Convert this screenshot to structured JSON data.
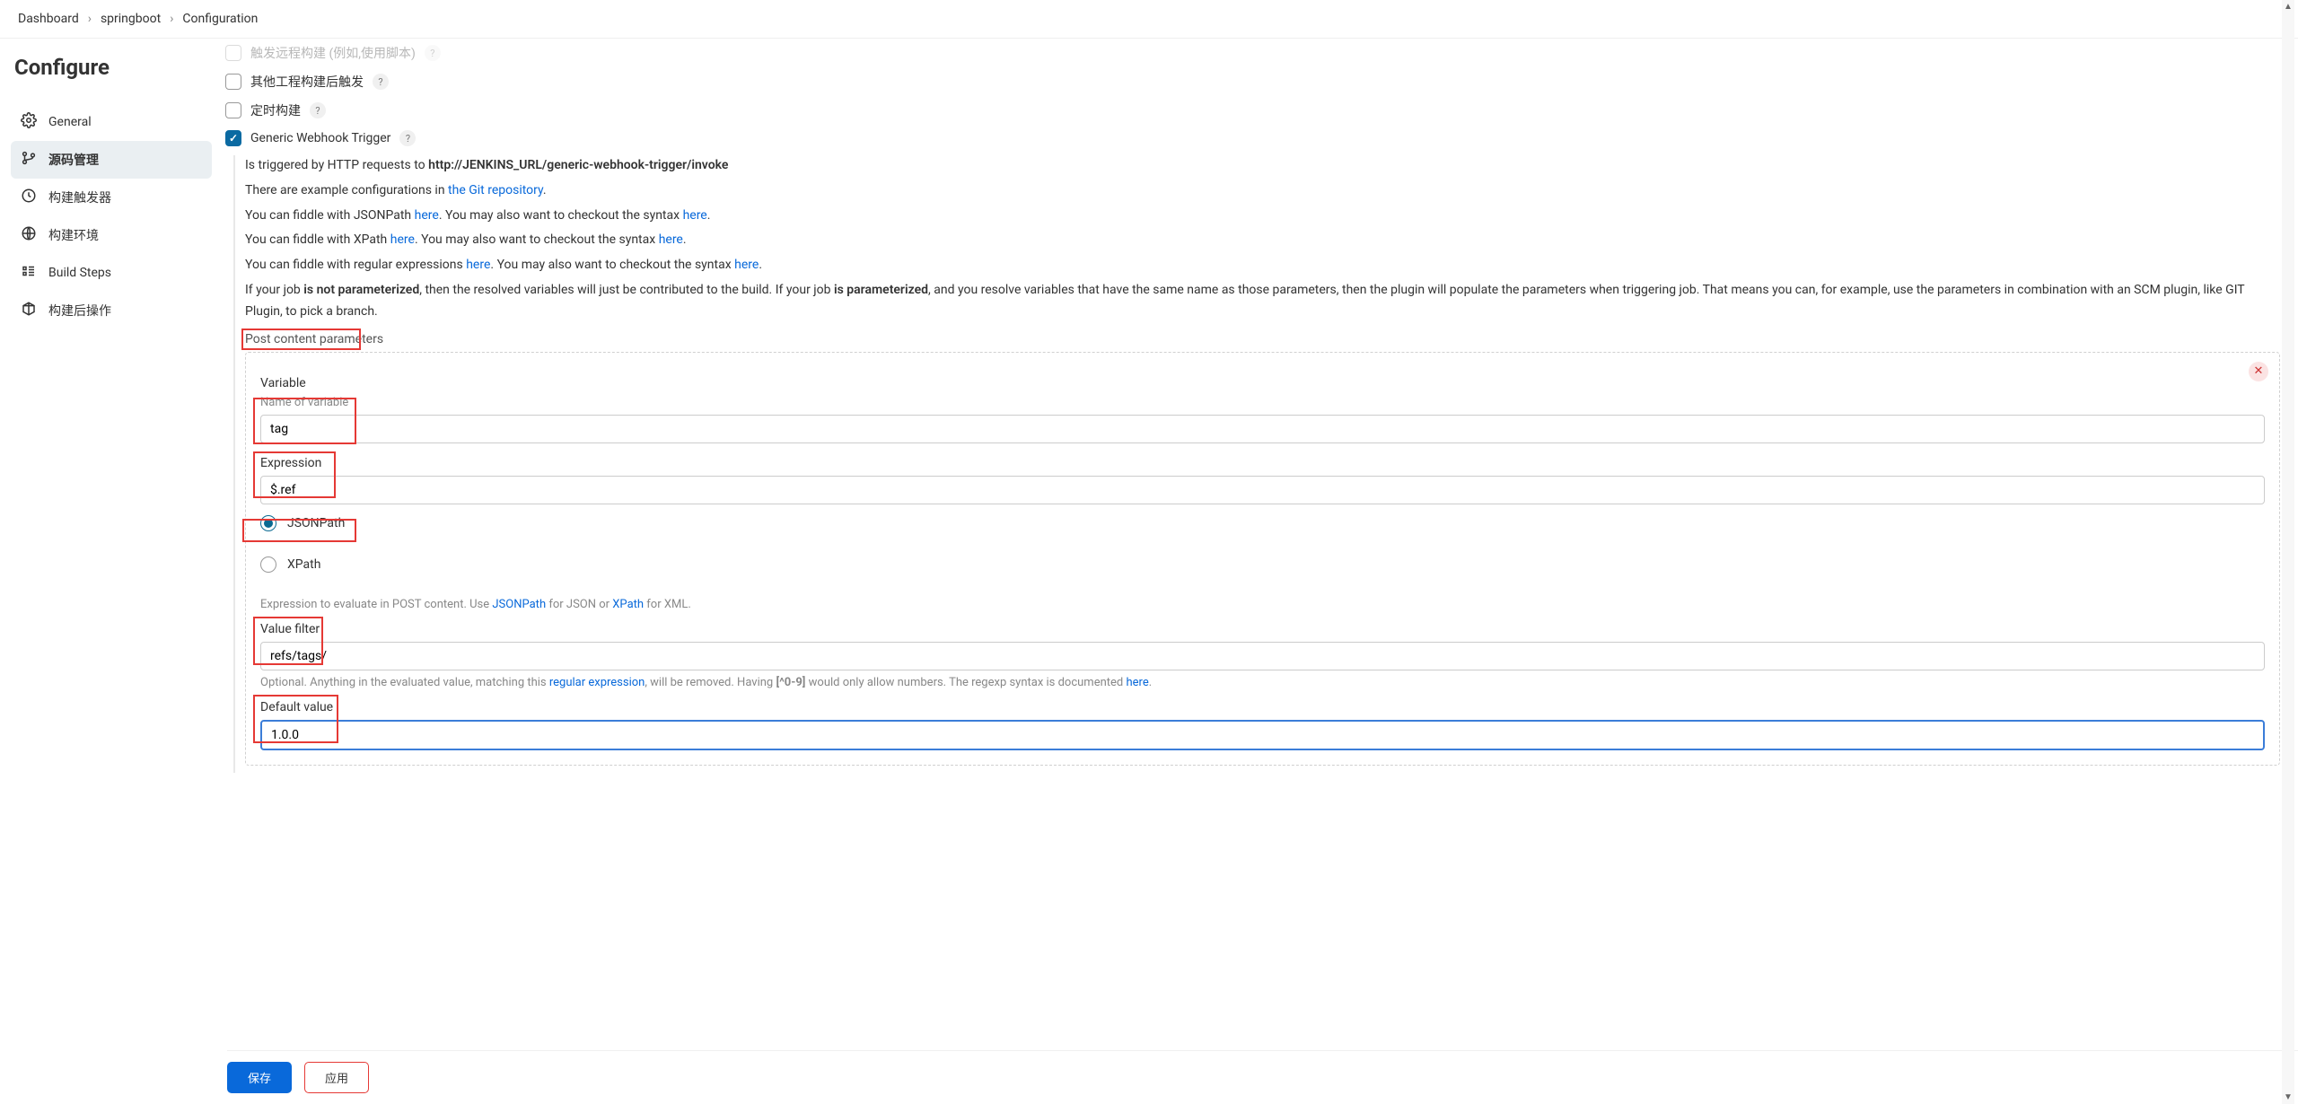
{
  "breadcrumb": {
    "dashboard": "Dashboard",
    "project": "springboot",
    "page": "Configuration"
  },
  "title": "Configure",
  "nav": {
    "general": "General",
    "scm": "源码管理",
    "triggers": "构建触发器",
    "env": "构建环境",
    "steps": "Build Steps",
    "post": "构建后操作"
  },
  "triggers": {
    "t0": "触发远程构建 (例如,使用脚本)",
    "t1": "其他工程构建后触发",
    "t2": "定时构建",
    "t3": "Generic Webhook Trigger"
  },
  "desc": {
    "l0a": "Is triggered by HTTP requests to ",
    "l0b": "http://JENKINS_URL/generic-webhook-trigger/invoke",
    "l1a": "There are example configurations in ",
    "l1b": "the Git repository",
    "l1c": ".",
    "l2a": "You can fiddle with JSONPath ",
    "l2b": "here",
    "l2c": ". You may also want to checkout the syntax ",
    "l2d": "here",
    "l2e": ".",
    "l3a": "You can fiddle with XPath ",
    "l3b": "here",
    "l3c": ". You may also want to checkout the syntax ",
    "l3d": "here",
    "l3e": ".",
    "l4a": "You can fiddle with regular expressions ",
    "l4b": "here",
    "l4c": ". You may also want to checkout the syntax ",
    "l4d": "here",
    "l4e": ".",
    "l5a": "If your job ",
    "l5b": "is not parameterized",
    "l5c": ", then the resolved variables will just be contributed to the build. If your job ",
    "l5d": "is parameterized",
    "l5e": ", and you resolve variables that have the same name as those parameters, then the plugin will populate the parameters when triggering job. That means you can, for example, use the parameters in combination with an SCM plugin, like GIT Plugin, to pick a branch."
  },
  "section": {
    "post_params": "Post content parameters"
  },
  "panel": {
    "variable_label": "Variable",
    "name_label": "Name of variable",
    "name_value": "tag",
    "expr_label": "Expression",
    "expr_value": "$.ref",
    "jsonpath": "JSONPath",
    "xpath": "XPath",
    "expr_hint_a": "Expression to evaluate in POST content. Use ",
    "expr_hint_b": "JSONPath",
    "expr_hint_c": " for JSON or ",
    "expr_hint_d": "XPath",
    "expr_hint_e": " for XML.",
    "filter_label": "Value filter",
    "filter_value": "refs/tags/",
    "filter_hint_a": "Optional. Anything in the evaluated value, matching this ",
    "filter_hint_b": "regular expression",
    "filter_hint_c": ", will be removed. Having ",
    "filter_hint_d": "[^0-9]",
    "filter_hint_e": " would only allow numbers. The regexp syntax is documented ",
    "filter_hint_f": "here",
    "filter_hint_g": ".",
    "default_label": "Default value",
    "default_value": "1.0.0"
  },
  "footer": {
    "save": "保存",
    "apply": "应用"
  }
}
